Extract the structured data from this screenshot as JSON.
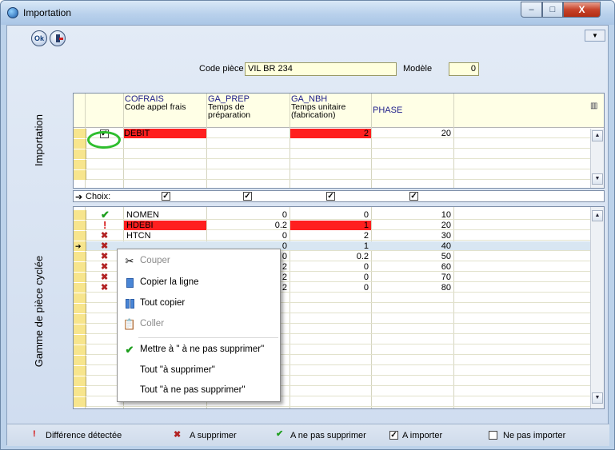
{
  "window": {
    "title": "Importation",
    "controls": {
      "minimize": "–",
      "maximize": "□",
      "close": "X"
    }
  },
  "toolbar": {
    "ok_label": "Ok",
    "exit_icon": "exit-door-icon"
  },
  "form": {
    "code_piece_label": "Code pièce",
    "code_piece_value": "VIL BR 234",
    "modele_label": "Modèle",
    "modele_value": "0"
  },
  "sections": {
    "top": "Importation",
    "bottom": "Gamme de pièce cyclée"
  },
  "columns": [
    {
      "code": "COFRAIS",
      "label": "Code appel frais"
    },
    {
      "code": "GA_PREP",
      "label": "Temps de préparation"
    },
    {
      "code": "GA_NBH",
      "label": "Temps unitaire (fabrication)"
    },
    {
      "code": "PHASE",
      "label": ""
    }
  ],
  "import_rows": [
    {
      "checked": true,
      "cofrais": "DEBIT",
      "ga_prep": "",
      "ga_nbh": "2",
      "phase": "20"
    }
  ],
  "choix_label": "Choix:",
  "gamme_rows": [
    {
      "status": "check",
      "cofrais": "NOMEN",
      "ga_prep": "0",
      "ga_nbh": "0",
      "phase": "10"
    },
    {
      "status": "diff",
      "cofrais": "HDEBI",
      "ga_prep": "0.2",
      "ga_nbh": "1",
      "phase": "20"
    },
    {
      "status": "delete",
      "cofrais": "HTCN",
      "ga_prep": "0",
      "ga_nbh": "2",
      "phase": "30"
    },
    {
      "status": "delete",
      "cofrais": "",
      "ga_prep": "0",
      "ga_nbh": "1",
      "phase": "40"
    },
    {
      "status": "delete",
      "cofrais": "",
      "ga_prep": "0",
      "ga_nbh": "0.2",
      "phase": "50"
    },
    {
      "status": "delete",
      "cofrais": "",
      "ga_prep": "2",
      "ga_nbh": "0",
      "phase": "60"
    },
    {
      "status": "delete",
      "cofrais": "",
      "ga_prep": "2",
      "ga_nbh": "0",
      "phase": "70"
    },
    {
      "status": "delete",
      "cofrais": "",
      "ga_prep": "2",
      "ga_nbh": "0",
      "phase": "80"
    }
  ],
  "context_menu": {
    "items": [
      {
        "label": "Couper",
        "icon": "scissors-icon",
        "enabled": false
      },
      {
        "label": "Copier la ligne",
        "icon": "copy-line-icon",
        "enabled": true
      },
      {
        "label": "Tout copier",
        "icon": "copy-all-icon",
        "enabled": true
      },
      {
        "label": "Coller",
        "icon": "paste-icon",
        "enabled": false
      },
      {
        "label": "Mettre à \" à ne pas supprimer\"",
        "icon": "check-icon",
        "enabled": true
      },
      {
        "label": "Tout \"à supprimer\"",
        "icon": "",
        "enabled": true
      },
      {
        "label": "Tout \"à ne pas supprimer\"",
        "icon": "",
        "enabled": true
      }
    ]
  },
  "legend": {
    "diff": "Différence détectée",
    "delete": "A supprimer",
    "keep": "A ne pas supprimer",
    "import": "A importer",
    "no_import": "Ne pas importer"
  },
  "colors": {
    "diff_red": "#ff1f1f",
    "field_yellow": "#ffffdd",
    "ok_green": "#1e9e1e",
    "highlight_ring": "#2ebe2e"
  }
}
